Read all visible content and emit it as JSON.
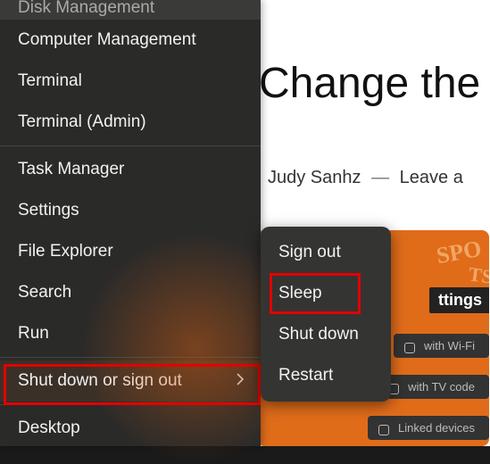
{
  "background": {
    "heading": "Change the",
    "author": "Judy Sanhz",
    "sep": "—",
    "cta": "Leave a",
    "tile_label": "ttings",
    "rows": [
      "with Wi-Fi",
      "with TV code",
      "Linked devices"
    ]
  },
  "winx_menu": {
    "items_top": [
      "Disk Management",
      "Computer Management",
      "Terminal",
      "Terminal (Admin)"
    ],
    "items_mid": [
      "Task Manager",
      "Settings",
      "File Explorer",
      "Search",
      "Run"
    ],
    "shutdown_label": "Shut down or sign out",
    "desktop_label": "Desktop"
  },
  "submenu": {
    "items": [
      "Sign out",
      "Sleep",
      "Shut down",
      "Restart"
    ]
  }
}
